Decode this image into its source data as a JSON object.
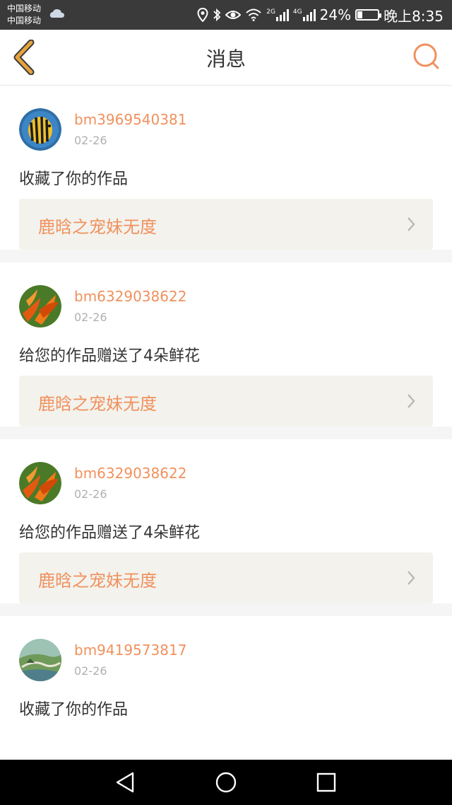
{
  "status_bar": {
    "carrier_line1": "中国移动",
    "carrier_line2": "中国移动",
    "battery_percent": "24%",
    "time": "晚上8:35",
    "network_1": "2G",
    "network_2": "4G"
  },
  "header": {
    "title": "消息"
  },
  "messages": [
    {
      "username": "bm3969540381",
      "date": "02-26",
      "text": "收藏了你的作品",
      "work_title": "鹿晗之宠妹无度",
      "avatar_icon": "fish-avatar"
    },
    {
      "username": "bm6329038622",
      "date": "02-26",
      "text": "给您的作品赠送了4朵鲜花",
      "work_title": "鹿晗之宠妹无度",
      "avatar_icon": "flower-avatar"
    },
    {
      "username": "bm6329038622",
      "date": "02-26",
      "text": "给您的作品赠送了4朵鲜花",
      "work_title": "鹿晗之宠妹无度",
      "avatar_icon": "flower-avatar"
    },
    {
      "username": "bm9419573817",
      "date": "02-26",
      "text": "收藏了你的作品",
      "avatar_icon": "landscape-avatar"
    }
  ],
  "colors": {
    "accent": "#f0915d",
    "back_arrow": "#e6a23c",
    "status_bar": "#3a3a3a",
    "card_link_bg": "#f3f2ed"
  }
}
